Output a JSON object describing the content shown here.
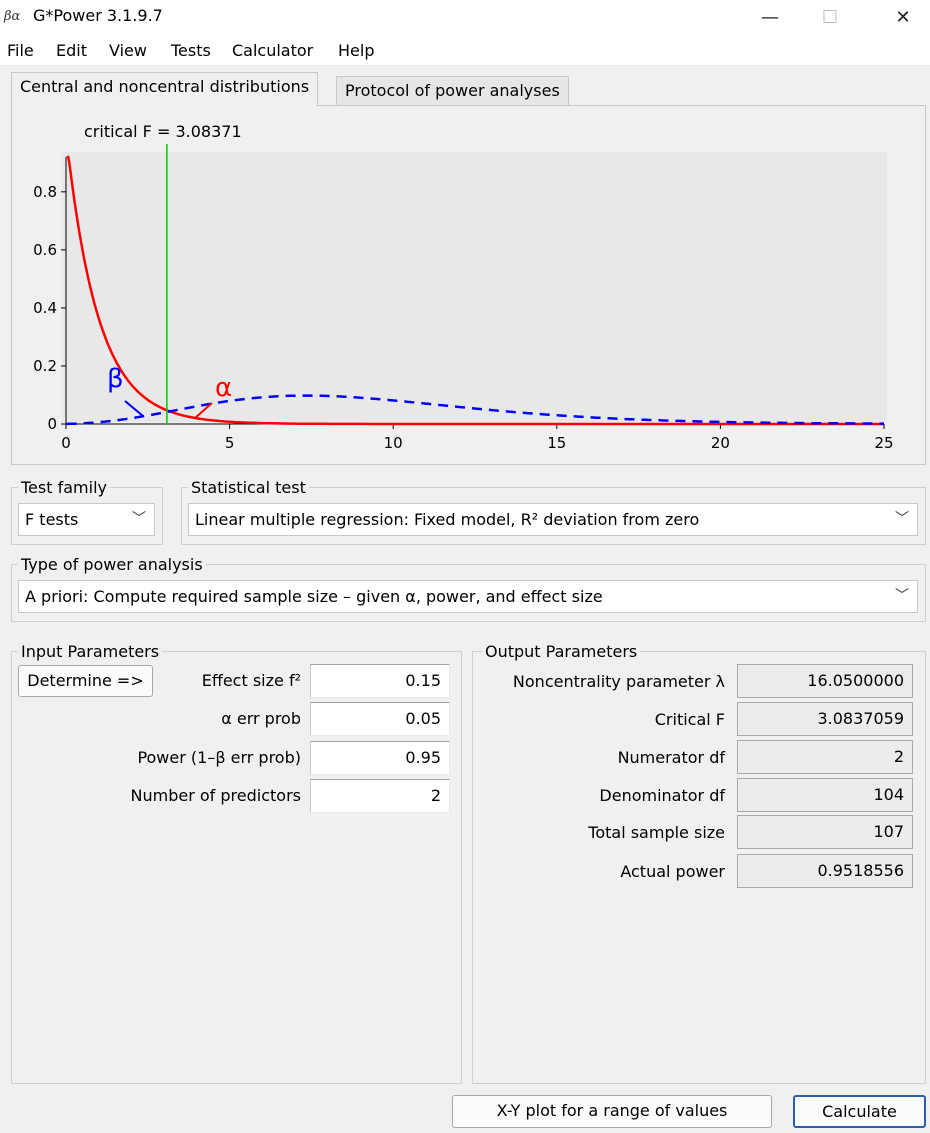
{
  "window": {
    "title": "G*Power 3.1.9.7",
    "icon_text": "βα",
    "controls": {
      "minimize": "—",
      "maximize": "☐",
      "close": "✕"
    }
  },
  "menu": [
    "File",
    "Edit",
    "View",
    "Tests",
    "Calculator",
    "Help"
  ],
  "tabs": {
    "distributions": "Central and noncentral distributions",
    "protocol": "Protocol of power analyses"
  },
  "plot": {
    "critical_label": "critical F = 3.08371",
    "critical_f": 3.08371,
    "beta_label": "β",
    "alpha_label": "α",
    "colors": {
      "central": "#ff0000",
      "noncentral": "#0000ff",
      "critical": "#00cc00",
      "plot_bg": "#e8e8e8"
    }
  },
  "chart_data": {
    "type": "line",
    "title": "critical F = 3.08371",
    "xlabel": "",
    "ylabel": "",
    "xlim": [
      0,
      25
    ],
    "ylim": [
      0,
      0.92
    ],
    "x_ticks": [
      "0",
      "5",
      "10",
      "15",
      "20",
      "25"
    ],
    "y_ticks": [
      "0",
      "0.2",
      "0.4",
      "0.6",
      "0.8"
    ],
    "series": [
      {
        "style": "solid",
        "color": "#ff0000",
        "df1": 2,
        "df2": 104,
        "lambda": 0
      },
      {
        "style": "dashed",
        "color": "#0000ff",
        "df1": 2,
        "df2": 104,
        "lambda": 16.05
      }
    ],
    "vlines": [
      {
        "x": 3.08371,
        "color": "#00cc00"
      }
    ],
    "annotations": [
      "β",
      "α"
    ]
  },
  "test_family": {
    "title": "Test family",
    "value": "F tests"
  },
  "statistical_test": {
    "title": "Statistical test",
    "value": "Linear multiple regression: Fixed model, R² deviation from zero"
  },
  "power_analysis": {
    "title": "Type of power analysis",
    "value": "A priori: Compute required sample size – given α, power, and effect size"
  },
  "input": {
    "title": "Input Parameters",
    "determine_button": "Determine =>",
    "rows": [
      {
        "label": "Effect size f²",
        "value": "0.15"
      },
      {
        "label": "α err prob",
        "value": "0.05"
      },
      {
        "label": "Power (1–β err prob)",
        "value": "0.95"
      },
      {
        "label": "Number of predictors",
        "value": "2"
      }
    ]
  },
  "output": {
    "title": "Output Parameters",
    "rows": [
      {
        "label": "Noncentrality parameter λ",
        "value": "16.0500000"
      },
      {
        "label": "Critical F",
        "value": "3.0837059"
      },
      {
        "label": "Numerator df",
        "value": "2"
      },
      {
        "label": "Denominator df",
        "value": "104"
      },
      {
        "label": "Total sample size",
        "value": "107"
      },
      {
        "label": "Actual power",
        "value": "0.9518556"
      }
    ]
  },
  "buttons": {
    "xy_plot": "X-Y plot for a range of values",
    "calculate": "Calculate"
  }
}
